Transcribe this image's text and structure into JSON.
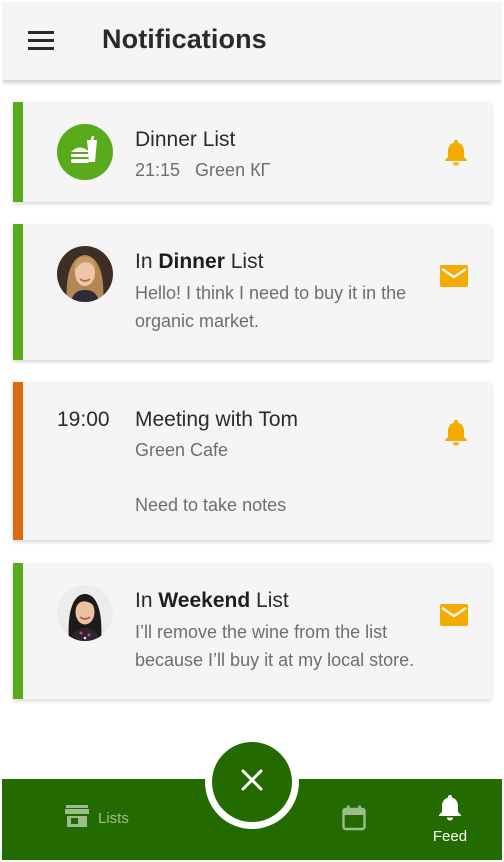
{
  "header": {
    "title": "Notifications",
    "menu_icon": "hamburger-menu-icon"
  },
  "colors": {
    "accent_green": "#5aab1b",
    "accent_orange": "#dd6a10",
    "bar_green": "#236b00",
    "notify_yellow": "#f5ab00"
  },
  "cards": [
    {
      "type": "reminder",
      "stripe": "green",
      "icon": "food-icon",
      "title": "Dinner List",
      "subtitle": "21:15   Green КГ",
      "action_icon": "bell-icon"
    },
    {
      "type": "message",
      "stripe": "green",
      "avatar": "avatar-blonde-woman",
      "title_prefix": "In",
      "title_bold": "Dinner",
      "title_suffix": "List",
      "body": "Hello! I think I need to buy it in the organic market.",
      "action_icon": "mail-icon"
    },
    {
      "type": "event",
      "stripe": "orange",
      "time": "19:00",
      "title": "Meeting with Tom",
      "subtitle": "Green Cafe",
      "note": "Need to take notes",
      "action_icon": "bell-icon"
    },
    {
      "type": "message",
      "stripe": "green",
      "avatar": "avatar-dark-hair-woman",
      "title_prefix": "In",
      "title_bold": "Weekend",
      "title_suffix": "List",
      "body": "I’ll remove the wine from the list because I’ll buy it at my local store.",
      "action_icon": "mail-icon"
    }
  ],
  "bottom_nav": {
    "lists_label": "Lists",
    "feed_label": "Feed",
    "fab_icon": "close-icon"
  }
}
